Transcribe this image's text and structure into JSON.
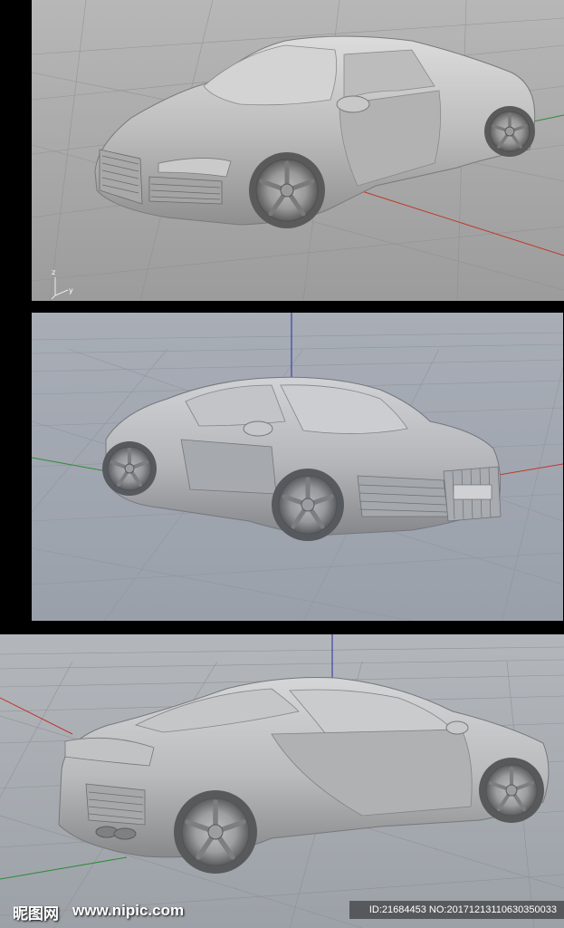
{
  "viewports": {
    "top": {
      "axis_labels": {
        "z": "z",
        "y": "y"
      }
    }
  },
  "watermark": {
    "logo": "昵图网",
    "url": "www.nipic.com",
    "id_text": "ID:21684453 NO:20171213110630350033"
  },
  "colors": {
    "background": "#000000",
    "axis_x": "#c0392b",
    "axis_y": "#2e8b3a",
    "axis_z": "#2c2ca8",
    "grid": "#8e8e8e",
    "car_body": "#c4c4c4"
  },
  "icons": [
    "axis-triad-icon"
  ]
}
